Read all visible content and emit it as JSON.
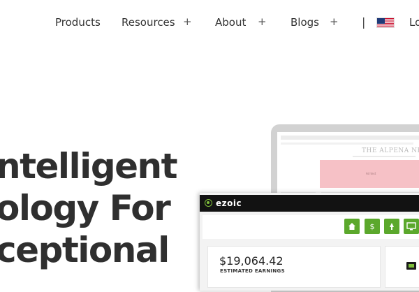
{
  "nav": {
    "items": [
      {
        "label": "Products",
        "has_submenu": false
      },
      {
        "label": "Resources",
        "has_submenu": true
      },
      {
        "label": "About",
        "has_submenu": true
      },
      {
        "label": "Blogs",
        "has_submenu": true
      }
    ],
    "submenu_glyph": "+",
    "divider": "|",
    "flag_icon": "us-flag-icon",
    "login_label": "Lo"
  },
  "hero": {
    "line1": "ntelligent",
    "line2": "ology For",
    "line3": "ceptional"
  },
  "mockup_back": {
    "site_title": "THE ALPENA NEWS",
    "ad_label": "Ad text",
    "ad_color": "#f6c1c6"
  },
  "mockup_front": {
    "brand": "ezoic",
    "brand_color": "#7fbf3a",
    "toolbar_icons": [
      "home-icon",
      "dollar-icon",
      "tree-icon",
      "monitor-icon"
    ],
    "button_color": "#5ba82c",
    "earnings_value": "$19,064.42",
    "earnings_label": "ESTIMATED EARNINGS"
  }
}
